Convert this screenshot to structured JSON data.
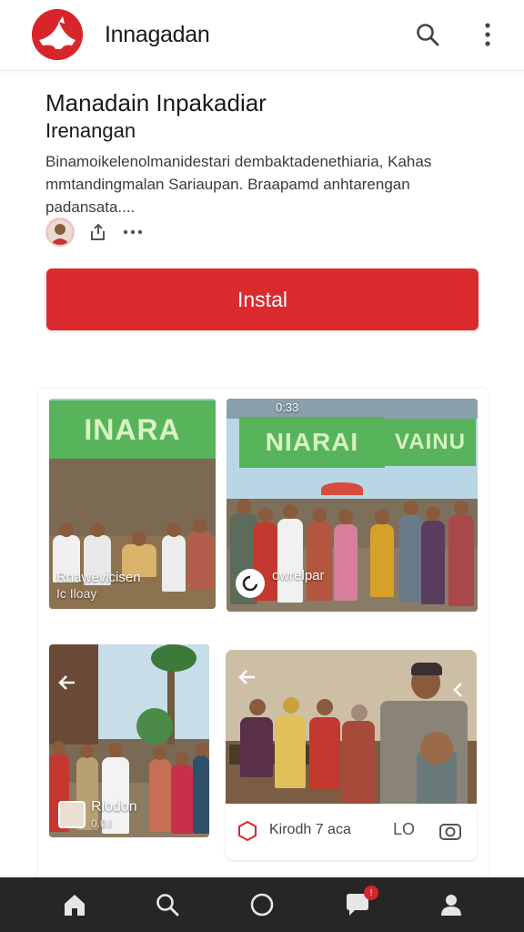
{
  "header": {
    "app_name": "Innagadan",
    "brand_color": "#d7262b",
    "search_icon": "search-icon",
    "menu_icon": "more-vertical-icon"
  },
  "post": {
    "title": "Manadain Inpakadiar",
    "subtitle": "Irenangan",
    "description": "Binamoikelenolmanidestari dembaktadenethiaria, Kahas mmtandingmalan Sariaupan. Braapamd anhtarengan padansata...."
  },
  "meta": {
    "share_icon": "share-icon",
    "more_icon": "more-horizontal-icon"
  },
  "install_button": {
    "label": "Instal",
    "color": "#db2a2e"
  },
  "gallery": {
    "photo1": {
      "banner": "INARA",
      "caption_line1": "Rnawevicisen",
      "caption_line2": "Ic Iloay"
    },
    "photo2": {
      "status_time": "0:33",
      "banner_left": "NIARAI",
      "banner_right": "VAINU",
      "caption": "owrelpar"
    },
    "photo3": {
      "caption_line1": "Rlodon",
      "caption_line2": "0.0.l"
    },
    "photo4": {
      "footer_text": "Kirodh 7 aca",
      "footer_badge": "LO"
    }
  },
  "bottom_nav": {
    "items": [
      "home-icon",
      "search-icon",
      "circle-icon",
      "chat-icon",
      "profile-icon"
    ],
    "chat_badge": "!"
  }
}
